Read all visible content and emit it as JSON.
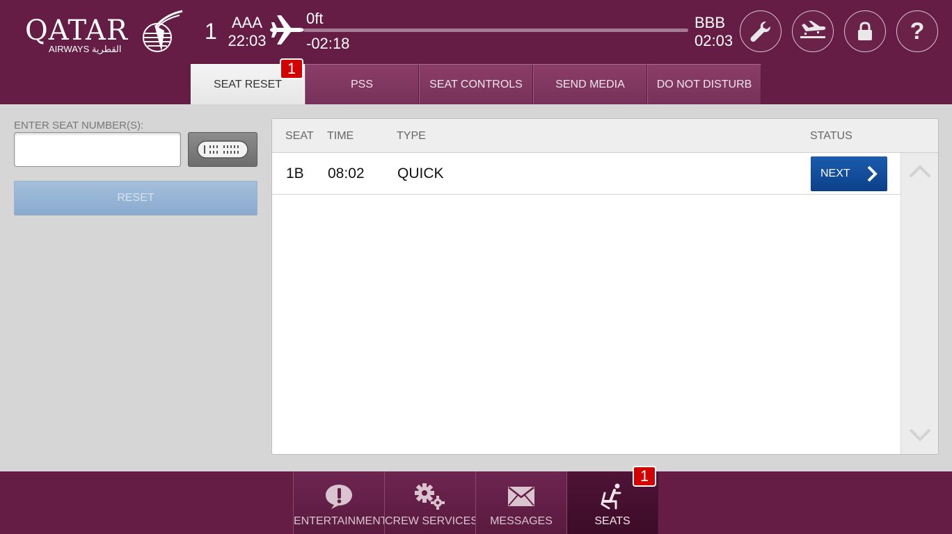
{
  "header": {
    "logo": {
      "wordmark": "QATAR",
      "sub": "AIRWAYS القطرية"
    },
    "flight_number": "1",
    "origin": {
      "code": "AAA",
      "time": "22:03"
    },
    "destination": {
      "code": "BBB",
      "time": "02:03"
    },
    "altitude": "0ft",
    "time_remaining": "-02:18",
    "buttons": [
      "wrench-icon",
      "landing-icon",
      "lock-icon",
      "help-icon"
    ],
    "help_label": "?"
  },
  "tabs": [
    {
      "label": "SEAT RESET",
      "active": true,
      "badge": "1"
    },
    {
      "label": "PSS"
    },
    {
      "label": "SEAT CONTROLS"
    },
    {
      "label": "SEND MEDIA"
    },
    {
      "label": "DO NOT DISTURB"
    }
  ],
  "left_panel": {
    "seat_label": "ENTER SEAT NUMBER(S):",
    "seat_value": "",
    "seat_placeholder": "",
    "reset_label": "RESET"
  },
  "table": {
    "columns": [
      "SEAT",
      "TIME",
      "TYPE",
      "STATUS"
    ],
    "rows": [
      {
        "seat": "1B",
        "time": "08:02",
        "type": "QUICK",
        "status": "NEXT"
      }
    ]
  },
  "bottom_nav": [
    {
      "label": "ENTERTAINMENT",
      "icon": "alert-bubble-icon"
    },
    {
      "label": "CREW SERVICES",
      "icon": "gears-icon"
    },
    {
      "label": "MESSAGES",
      "icon": "envelope-icon"
    },
    {
      "label": "SEATS",
      "icon": "seat-icon",
      "active": true,
      "badge": "1"
    }
  ],
  "colors": {
    "brand": "#651d45",
    "accent_blue": "#1a5cae",
    "badge_red": "#d40000"
  }
}
